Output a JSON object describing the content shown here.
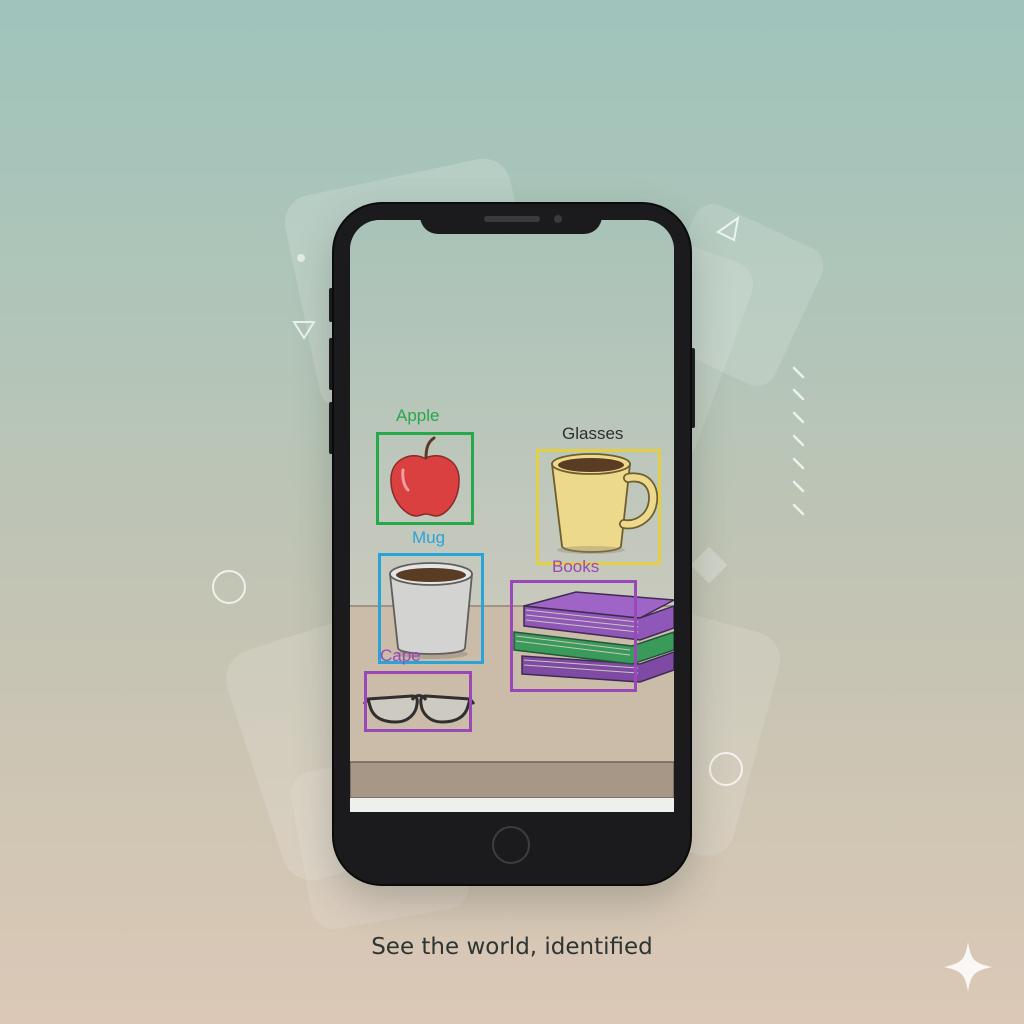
{
  "tagline": "See the world, identified",
  "detections": [
    {
      "label": "Apple",
      "color": "#27a84a"
    },
    {
      "label": "Glasses",
      "color": "#e2cf45"
    },
    {
      "label": "Mug",
      "color": "#2aa3d6"
    },
    {
      "label": "Books",
      "color": "#9a48b8"
    },
    {
      "label": "Cape",
      "color": "#9a48b8"
    }
  ],
  "colors": {
    "phone_body": "#1b1b1d",
    "desk": "#cbbba9",
    "apple": "#d9403f",
    "mug_yellow": "#ecd98b",
    "cup_grey": "#d3d3d1"
  }
}
